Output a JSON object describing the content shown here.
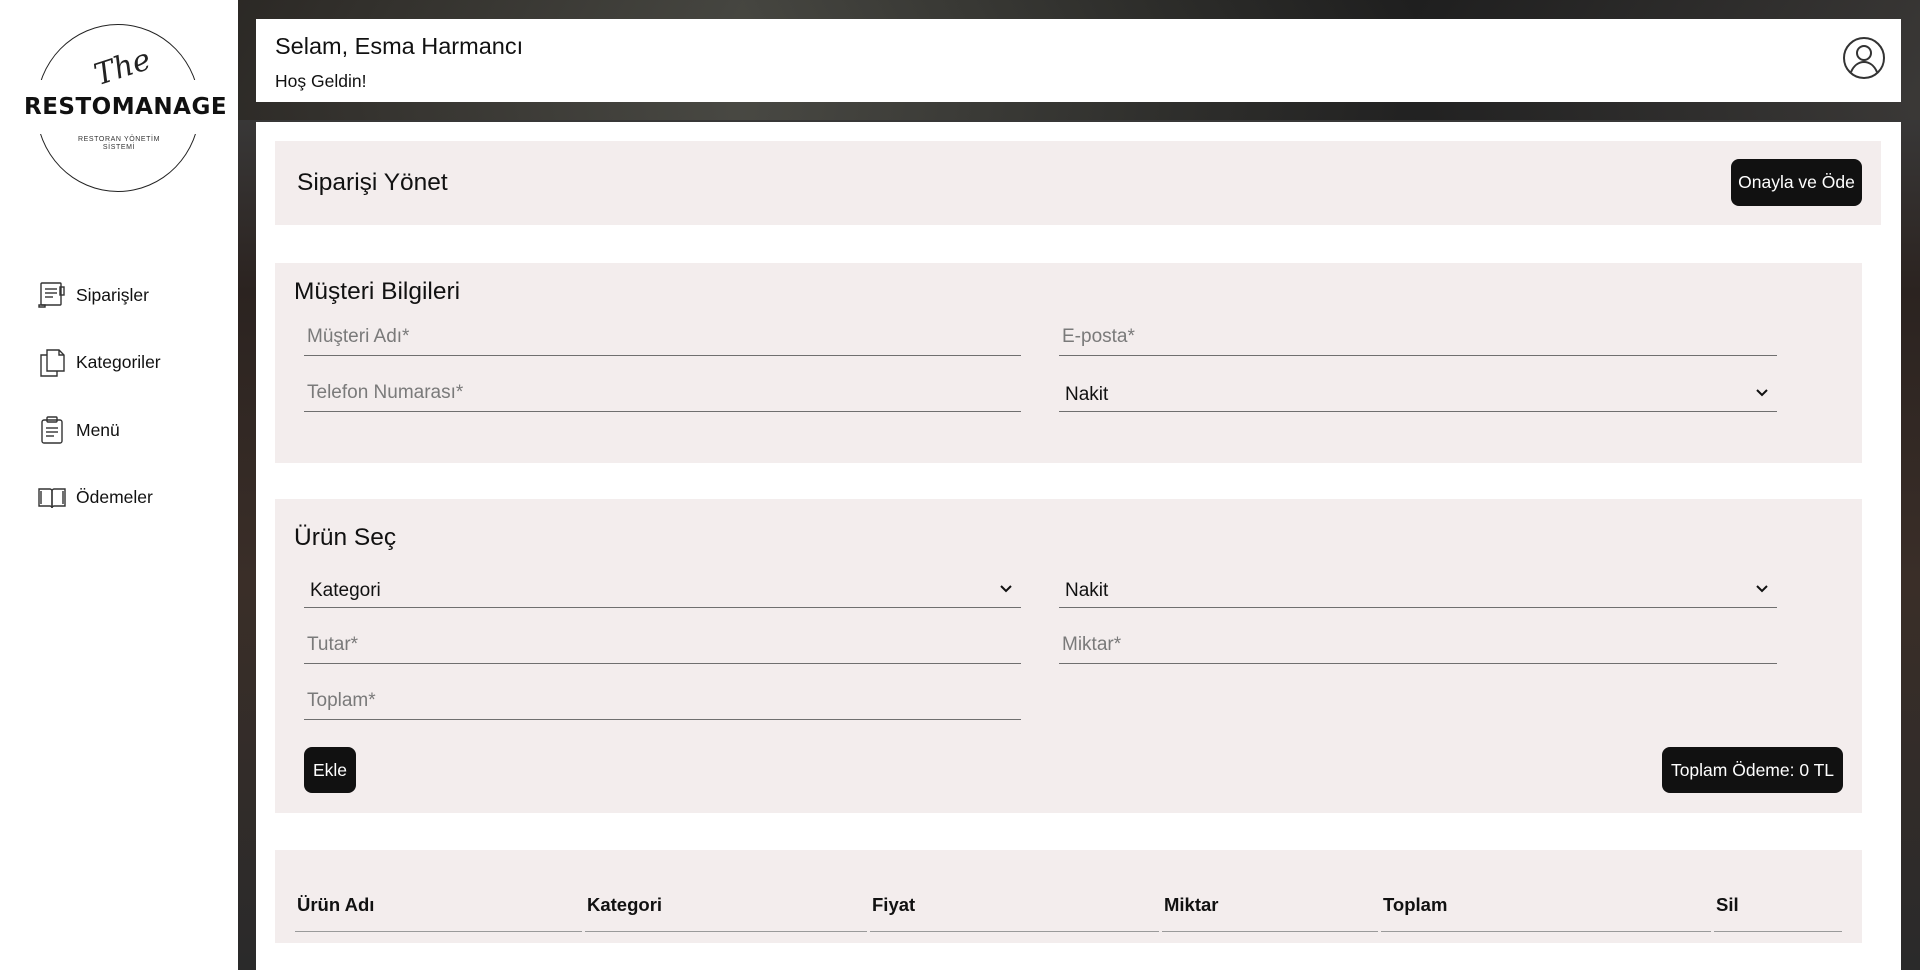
{
  "sidebar": {
    "logo": {
      "script": "The",
      "brand": "RESTOMANAGE",
      "subtitle": "RESTORAN YÖNETİM SİSTEMİ"
    },
    "items": [
      {
        "label": "Siparişler",
        "icon": "order-receipt-icon"
      },
      {
        "label": "Kategoriler",
        "icon": "documents-icon"
      },
      {
        "label": "Menü",
        "icon": "clipboard-icon"
      },
      {
        "label": "Ödemeler",
        "icon": "book-icon"
      }
    ]
  },
  "header": {
    "greeting": "Selam, Esma Harmancı",
    "welcome": "Hoş Geldin!",
    "user_icon": "user-circle-icon"
  },
  "manage": {
    "title": "Siparişi Yönet",
    "confirm_label": "Onayla ve Öde"
  },
  "customer": {
    "title": "Müşteri Bilgileri",
    "name_placeholder": "Müşteri Adı*",
    "email_placeholder": "E-posta*",
    "phone_placeholder": "Telefon Numarası*",
    "payment_selected": "Nakit"
  },
  "product": {
    "title": "Ürün Seç",
    "category_selected": "Kategori",
    "product_selected": "Nakit",
    "price_placeholder": "Tutar*",
    "quantity_placeholder": "Miktar*",
    "total_placeholder": "Toplam*",
    "add_label": "Ekle",
    "total_payment_label": "Toplam Ödeme: 0 TL"
  },
  "table": {
    "headers": [
      "Ürün Adı",
      "Kategori",
      "Fiyat",
      "Miktar",
      "Toplam",
      "Sil"
    ]
  },
  "colors": {
    "section_bg": "#f3eded",
    "button_bg": "#111111",
    "button_text": "#ffffff"
  }
}
